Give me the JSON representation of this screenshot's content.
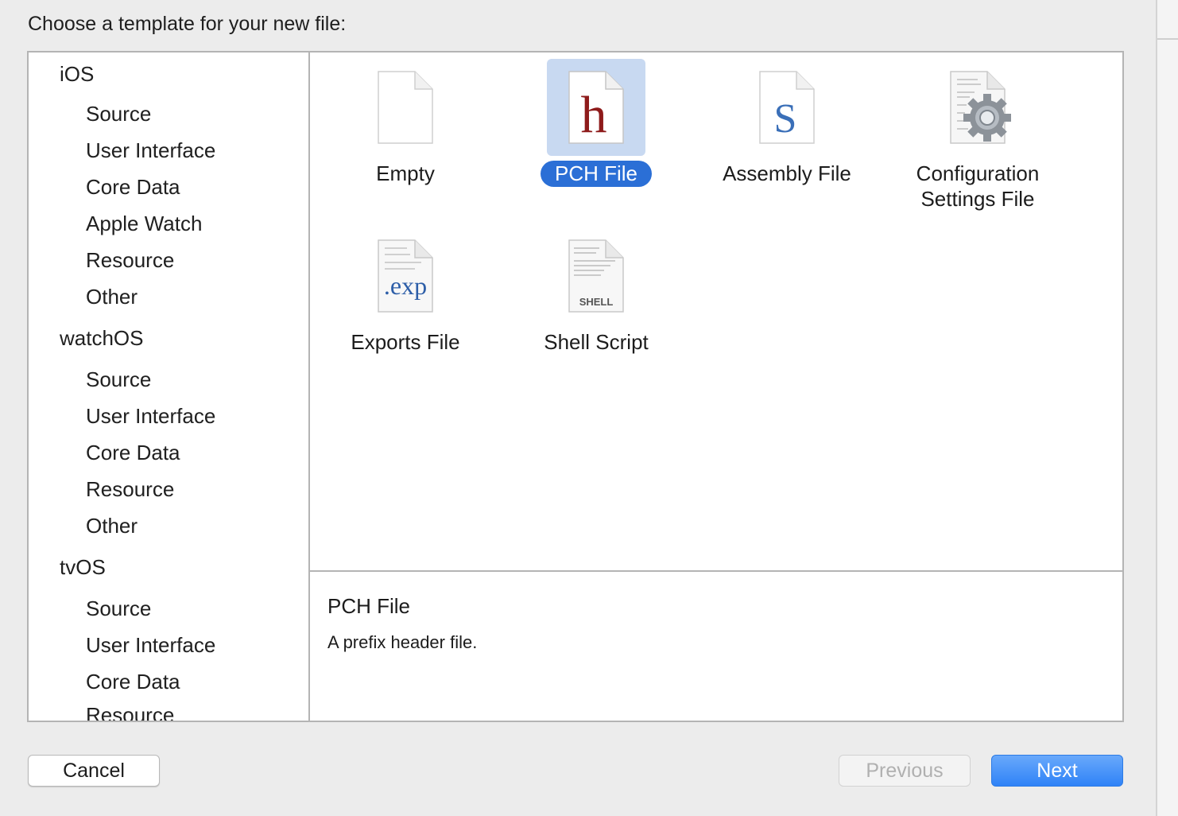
{
  "dialog": {
    "prompt": "Choose a template for your new file:"
  },
  "sidebar": {
    "categories": [
      {
        "label": "iOS",
        "level": "platform"
      },
      {
        "label": "Source",
        "level": "sub"
      },
      {
        "label": "User Interface",
        "level": "sub"
      },
      {
        "label": "Core Data",
        "level": "sub"
      },
      {
        "label": "Apple Watch",
        "level": "sub"
      },
      {
        "label": "Resource",
        "level": "sub"
      },
      {
        "label": "Other",
        "level": "sub"
      },
      {
        "label": "watchOS",
        "level": "platform"
      },
      {
        "label": "Source",
        "level": "sub"
      },
      {
        "label": "User Interface",
        "level": "sub"
      },
      {
        "label": "Core Data",
        "level": "sub"
      },
      {
        "label": "Resource",
        "level": "sub"
      },
      {
        "label": "Other",
        "level": "sub"
      },
      {
        "label": "tvOS",
        "level": "platform"
      },
      {
        "label": "Source",
        "level": "sub"
      },
      {
        "label": "User Interface",
        "level": "sub"
      },
      {
        "label": "Core Data",
        "level": "sub"
      },
      {
        "label": "Resource",
        "level": "sub"
      }
    ]
  },
  "templates": {
    "items": [
      {
        "label": "Empty",
        "icon": "empty-file-icon",
        "selected": false
      },
      {
        "label": "PCH File",
        "icon": "header-file-icon",
        "glyph": "h",
        "selected": true
      },
      {
        "label": "Assembly File",
        "icon": "assembly-file-icon",
        "glyph": "S",
        "selected": false
      },
      {
        "label_line1": "Configuration",
        "label_line2": "Settings File",
        "icon": "config-settings-gear-icon",
        "selected": false
      },
      {
        "label": "Exports File",
        "icon": "exports-file-icon",
        "glyph": ".exp",
        "selected": false
      },
      {
        "label": "Shell Script",
        "icon": "shell-script-icon",
        "glyph": "SHELL",
        "selected": false
      }
    ]
  },
  "description": {
    "title": "PCH File",
    "text": "A prefix header file."
  },
  "buttons": {
    "cancel": "Cancel",
    "previous": "Previous",
    "next": "Next"
  },
  "colors": {
    "accent": "#2b6fd6",
    "selection_bg": "#c8d9f1",
    "next_button": "#3d8ef8"
  }
}
